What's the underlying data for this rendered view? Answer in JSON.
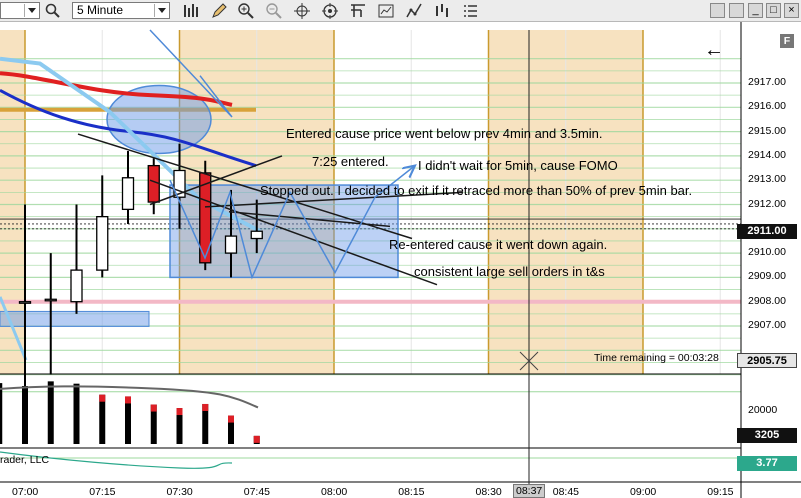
{
  "toolbar": {
    "instrument_value": "",
    "interval_value": "5 Minute",
    "icons": [
      "search-icon",
      "bar-style-icon",
      "pencil-icon",
      "zoom-in-icon",
      "zoom-out-icon",
      "crosshair-icon",
      "target-icon",
      "data-box-icon",
      "chart-properties-icon",
      "indicators-icon",
      "strategies-icon",
      "list-icon"
    ]
  },
  "window_buttons": {
    "minimize": "_",
    "maximize": "□",
    "close": "×"
  },
  "chart": {
    "type": "candlestick",
    "price_ticks": [
      "2917.00",
      "2916.00",
      "2915.00",
      "2914.00",
      "2913.00",
      "2912.00",
      "2911.00",
      "2910.00",
      "2909.00",
      "2908.00",
      "2907.00",
      "2905.75"
    ],
    "current_price": "2911.00",
    "last_price_badge": "2905.75",
    "time_remaining": "Time remaining = 00:03:28",
    "time_ticks": [
      "07:00",
      "07:15",
      "07:30",
      "07:45",
      "08:00",
      "08:15",
      "08:30",
      "08:45",
      "09:00",
      "09:15"
    ],
    "crosshair_time": "08:37",
    "panel_label": "F",
    "candles": [
      {
        "t": "07:00",
        "o": 2908.0,
        "h": 2912.0,
        "l": 2903.0,
        "c": 2908.0,
        "color": "white"
      },
      {
        "t": "07:05",
        "o": 2908.1,
        "h": 2910.0,
        "l": 2905.0,
        "c": 2908.1,
        "color": "white"
      },
      {
        "t": "07:10",
        "o": 2908.0,
        "h": 2912.0,
        "l": 2907.5,
        "c": 2909.3,
        "color": "white"
      },
      {
        "t": "07:15",
        "o": 2909.3,
        "h": 2913.2,
        "l": 2909.0,
        "c": 2911.5,
        "color": "white"
      },
      {
        "t": "07:20",
        "o": 2911.8,
        "h": 2914.2,
        "l": 2911.2,
        "c": 2913.1,
        "color": "white"
      },
      {
        "t": "07:25",
        "o": 2913.6,
        "h": 2913.9,
        "l": 2911.6,
        "c": 2912.1,
        "color": "red"
      },
      {
        "t": "07:30",
        "o": 2912.3,
        "h": 2914.5,
        "l": 2911.0,
        "c": 2913.4,
        "color": "white"
      },
      {
        "t": "07:35",
        "o": 2913.3,
        "h": 2913.8,
        "l": 2909.3,
        "c": 2909.6,
        "color": "red"
      },
      {
        "t": "07:40",
        "o": 2910.0,
        "h": 2912.6,
        "l": 2909.0,
        "c": 2910.7,
        "color": "white"
      },
      {
        "t": "07:45",
        "o": 2910.6,
        "h": 2912.2,
        "l": 2910.0,
        "c": 2910.9,
        "color": "white"
      }
    ],
    "volume_badge": "3205",
    "volume_tick": "20000",
    "volumes": [
      {
        "t": "06:55",
        "v": 21500,
        "color": "black"
      },
      {
        "t": "07:00",
        "v": 21000,
        "color": "black"
      },
      {
        "t": "07:05",
        "v": 21800,
        "color": "black"
      },
      {
        "t": "07:10",
        "v": 21400,
        "color": "black"
      },
      {
        "t": "07:15",
        "v": 19500,
        "color": "black",
        "top_red": true
      },
      {
        "t": "07:20",
        "v": 19200,
        "color": "black",
        "top_red": true
      },
      {
        "t": "07:25",
        "v": 17800,
        "color": "black",
        "top_red": true
      },
      {
        "t": "07:30",
        "v": 17200,
        "color": "black",
        "top_red": true
      },
      {
        "t": "07:35",
        "v": 17900,
        "color": "black",
        "top_red": true
      },
      {
        "t": "07:40",
        "v": 15900,
        "color": "black",
        "top_red": true
      },
      {
        "t": "07:45",
        "v": 12400,
        "color": "black",
        "top_red": true
      }
    ],
    "indicator_badge": "3.77",
    "indicator_label": "rader, LLC"
  },
  "annotations": {
    "a1": "Entered cause price went below prev 4min and 3.5min.",
    "a2": "7:25 entered.",
    "a3": "I didn't wait for 5min, cause FOMO",
    "a4": "Stopped out. I decided to exit if it retraced more than 50% of prev 5min bar.",
    "a5": "Re-entered cause it went down again.",
    "a6": "consistent large sell orders in t&s"
  },
  "colors": {
    "session_band": "#f7e2c0",
    "grid_green": "#9ed89e",
    "sma_red": "#e02020",
    "sma_blue": "#1a2fc8",
    "sma_lightblue": "#8ccaf0",
    "gold_line": "#d8a23a",
    "pink_line": "#f3b8c6",
    "time_sep": "#c99a2e",
    "highlight": "#6b9ae8",
    "indicator_green": "#2ca88c"
  }
}
